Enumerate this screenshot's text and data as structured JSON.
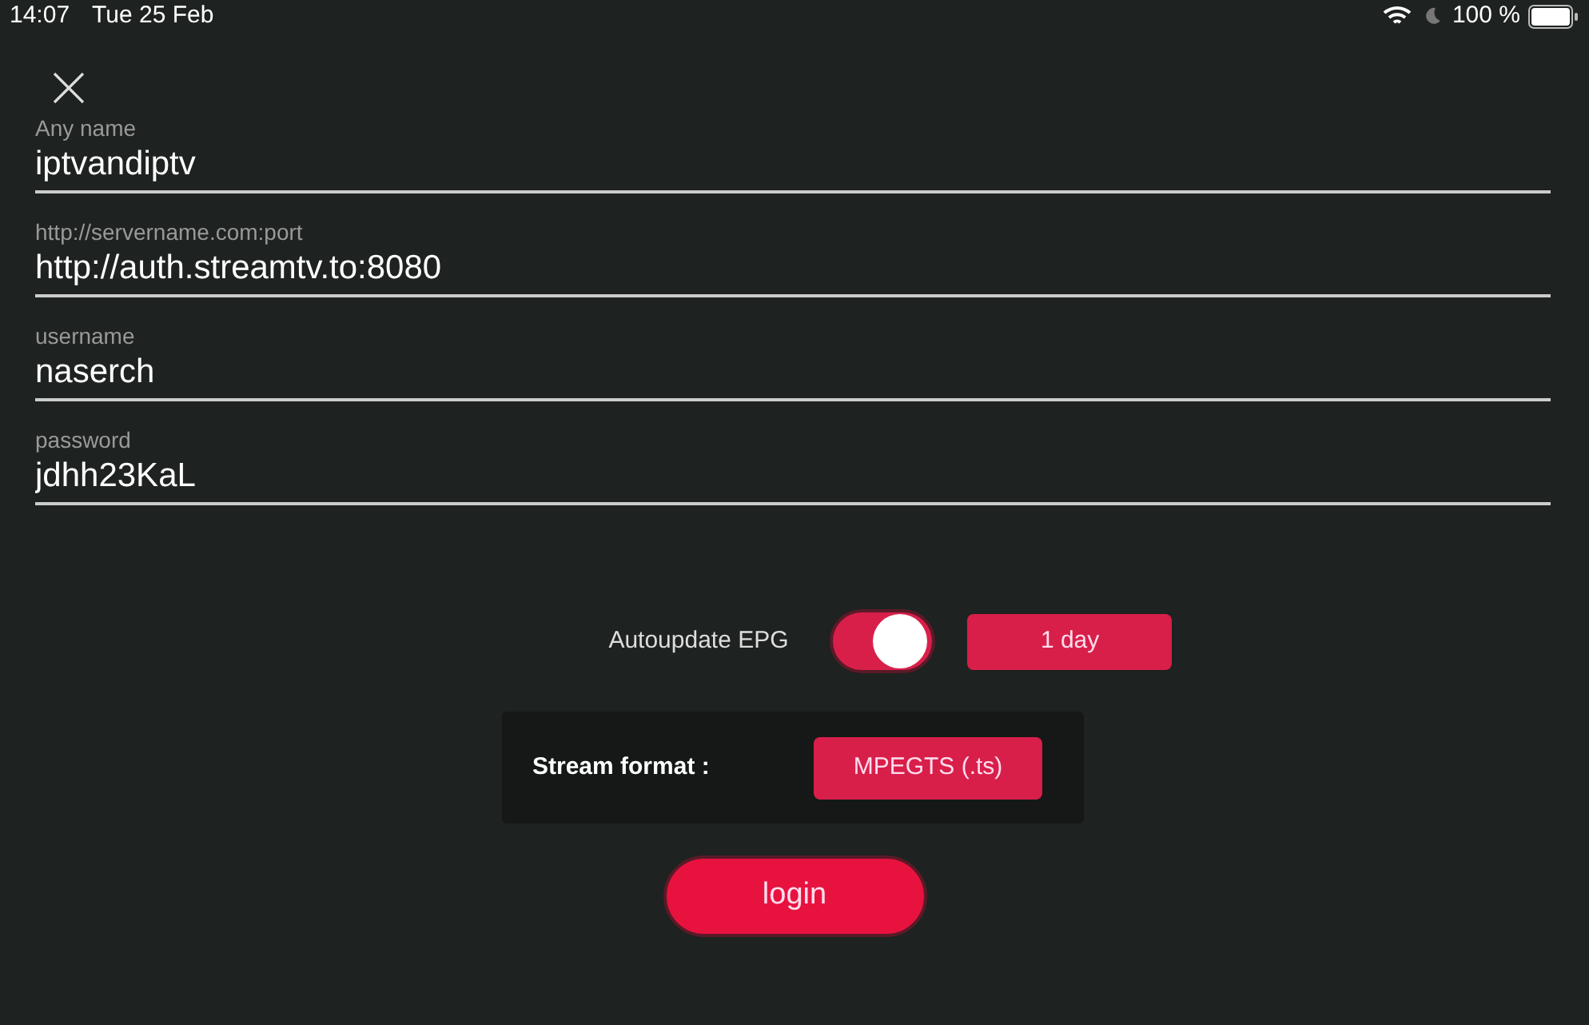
{
  "status_bar": {
    "time": "14:07",
    "date": "Tue 25 Feb",
    "battery": "100 %"
  },
  "fields": [
    {
      "label": "Any name",
      "value": "iptvandiptv"
    },
    {
      "label": "http://servername.com:port",
      "value": "http://auth.streamtv.to:8080"
    },
    {
      "label": "username",
      "value": "naserch"
    },
    {
      "label": "password",
      "value": "jdhh23KaL"
    }
  ],
  "autoupdate": {
    "label": "Autoupdate EPG",
    "on": true,
    "interval": "1 day"
  },
  "stream_format": {
    "label": "Stream format :",
    "value": "MPEGTS (.ts)"
  },
  "login_button": "login"
}
